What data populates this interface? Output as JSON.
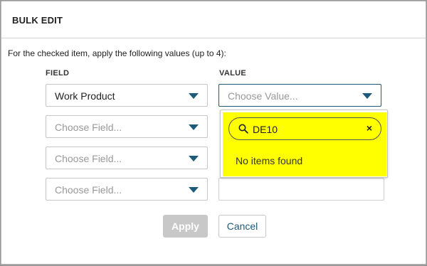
{
  "dialog": {
    "title": "BULK EDIT",
    "instructions": "For the checked item, apply the following values (up to 4):"
  },
  "columns": {
    "field": "FIELD",
    "value": "VALUE"
  },
  "rows": [
    {
      "field": "Work Product",
      "field_filled": true
    },
    {
      "field": "Choose Field...",
      "field_filled": false
    },
    {
      "field": "Choose Field...",
      "field_filled": false
    },
    {
      "field": "Choose Field...",
      "field_filled": false
    }
  ],
  "value_select": {
    "placeholder": "Choose Value..."
  },
  "dropdown": {
    "search_value": "DE10",
    "clear_symbol": "×",
    "empty_message": "No items found",
    "highlight_color": "#ffff00"
  },
  "buttons": {
    "apply": "Apply",
    "cancel": "Cancel"
  },
  "colors": {
    "accent": "#1e5a7a",
    "disabled": "#c8c8c8"
  },
  "icons": {
    "search": "search-icon",
    "clear": "close-icon",
    "dropdown": "chevron-down-icon"
  }
}
